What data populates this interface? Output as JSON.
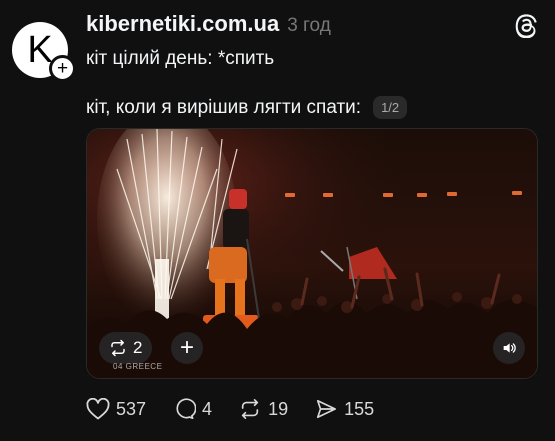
{
  "post": {
    "avatar_letter": "K",
    "follow_symbol": "+",
    "username": "kibernetiki.com.ua",
    "timestamp": "3 год",
    "text_line_1": "кіт цілий день: *спить",
    "text_line_2": "кіт, коли я вирішив лягти спати:",
    "page_indicator": "1/2"
  },
  "media": {
    "repost_count": "2",
    "add_symbol": "+",
    "caption_overlay": "04 GREECE"
  },
  "actions": {
    "likes": "537",
    "replies": "4",
    "reposts": "19",
    "shares": "155"
  },
  "icons": {
    "threads_logo": "threads-logo-icon",
    "like": "heart-icon",
    "reply": "comment-icon",
    "repost": "repost-icon",
    "share": "send-icon",
    "sound": "speaker-icon"
  }
}
